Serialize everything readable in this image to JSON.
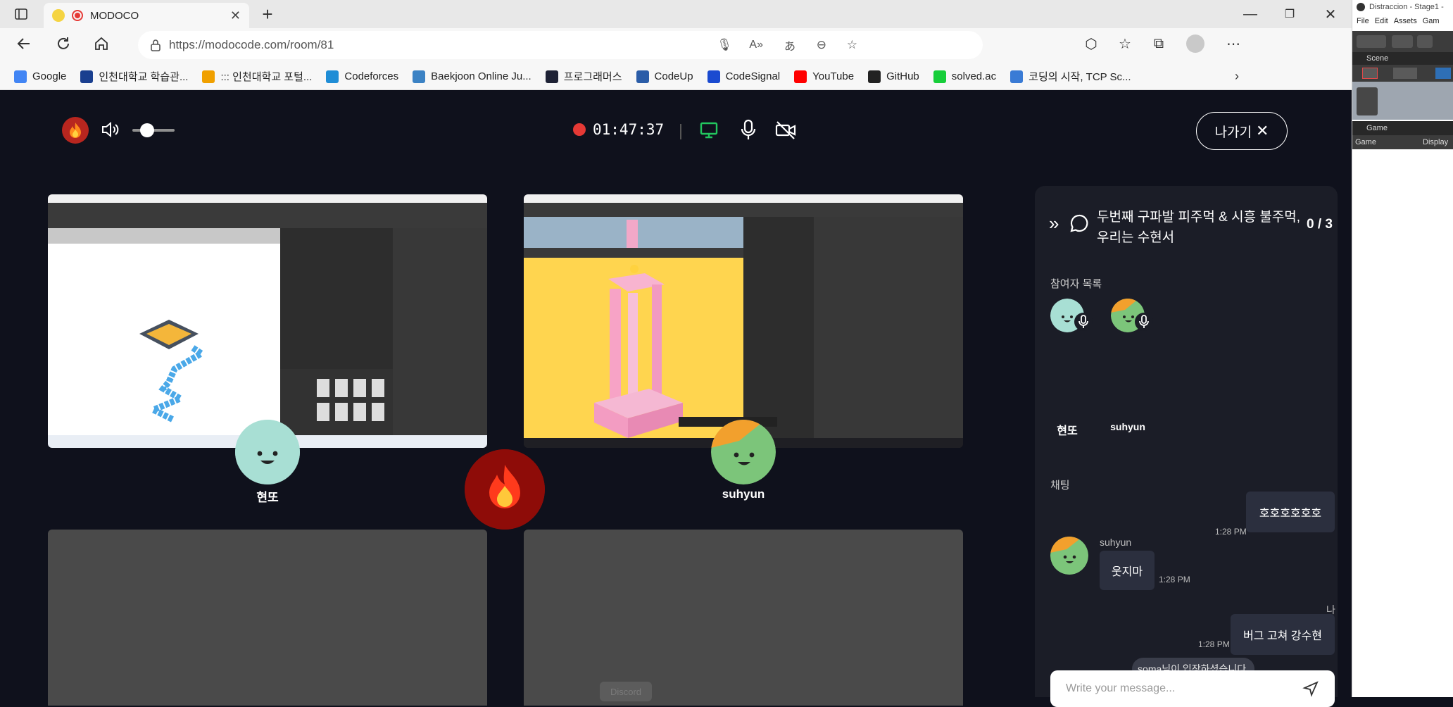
{
  "browser": {
    "tab_title": "MODOCO",
    "url": "https://modocode.com/room/81",
    "bookmarks": [
      {
        "label": "Google",
        "color": "#4285f4"
      },
      {
        "label": "인천대학교 학습관...",
        "color": "#1a3f8f"
      },
      {
        "label": "::: 인천대학교 포털...",
        "color": "#f0a000"
      },
      {
        "label": "Codeforces",
        "color": "#1f8dd6"
      },
      {
        "label": "Baekjoon Online Ju...",
        "color": "#3b82c4"
      },
      {
        "label": "프로그래머스",
        "color": "#1e2235"
      },
      {
        "label": "CodeUp",
        "color": "#2b5da8"
      },
      {
        "label": "CodeSignal",
        "color": "#1a4ad0"
      },
      {
        "label": "YouTube",
        "color": "#ff0000"
      },
      {
        "label": "GitHub",
        "color": "#222222"
      },
      {
        "label": "solved.ac",
        "color": "#17ce3a"
      },
      {
        "label": "코딩의 시작, TCP Sc...",
        "color": "#3a7bd5"
      }
    ]
  },
  "unity": {
    "title": "Distraccion - Stage1 -",
    "menu": [
      "File",
      "Edit",
      "Assets",
      "Gam"
    ],
    "scene_tab": "Scene",
    "game_tab": "Game",
    "game_dropdown": "Game",
    "display_label": "Display"
  },
  "controls": {
    "timer": "01:47:37",
    "exit_label": "나가기",
    "volume_level": 0.35
  },
  "participants_tiles": [
    {
      "name": "현또",
      "avatar_color": "#a8dfd4"
    },
    {
      "name": "suhyun",
      "avatar_color": "#f2a02d"
    }
  ],
  "empty_tile_label": "Discord",
  "panel": {
    "room_title": "두번째 구파발 피주먹 & 시흥 불주먹, 우리는 수현서",
    "count": "0 / 3",
    "participants_heading": "참여자 목록",
    "participants": [
      {
        "name": "현또"
      },
      {
        "name": "suhyun"
      }
    ],
    "chat_heading": "채팅",
    "messages": [
      {
        "text": "호호호호호호",
        "time": "1:28 PM"
      },
      {
        "sender": "suhyun",
        "text": "웃지마",
        "time": "1:28 PM"
      },
      {
        "sender": "나",
        "text": "버그 고쳐 강수현",
        "time": "1:28 PM"
      }
    ],
    "notice": "soma님이 입장하셨습니다.",
    "input_placeholder": "Write your message..."
  },
  "colors": {
    "background": "#0f111c",
    "panel": "#1b1d27",
    "accent_green": "#22c55e",
    "record_red": "#e53935"
  }
}
